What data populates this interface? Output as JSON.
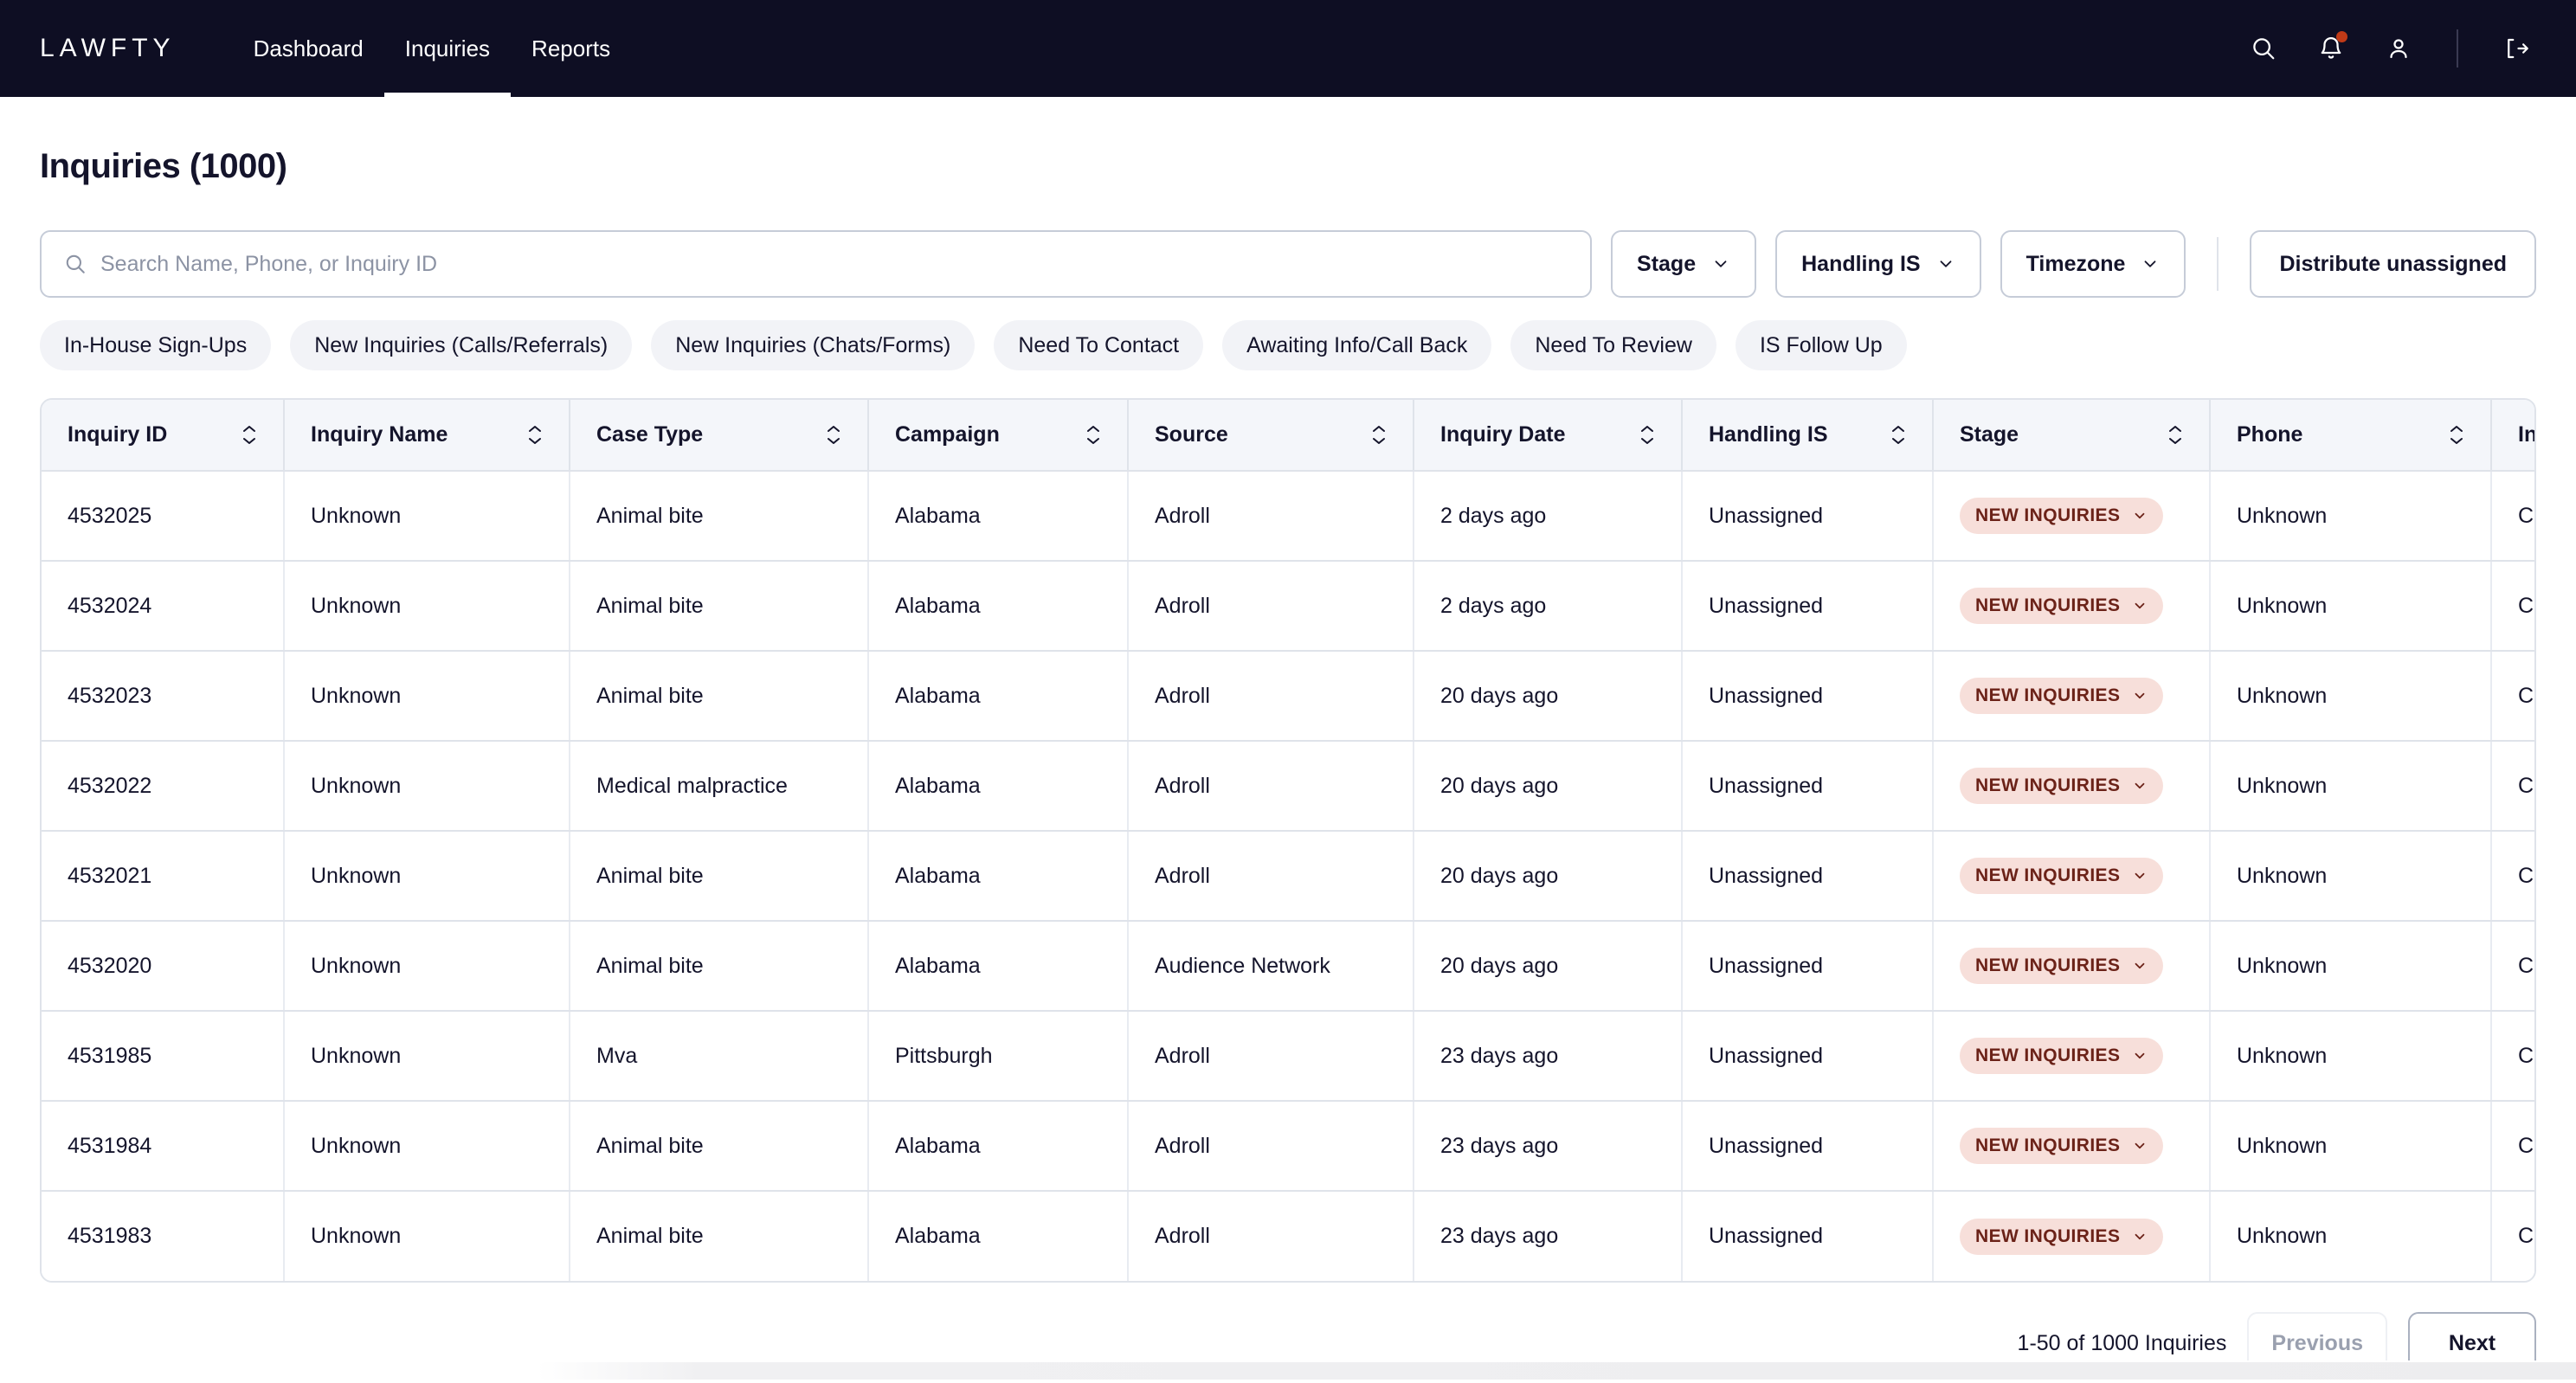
{
  "navbar": {
    "logo": "LAWFTY",
    "links": [
      {
        "label": "Dashboard",
        "active": false
      },
      {
        "label": "Inquiries",
        "active": true
      },
      {
        "label": "Reports",
        "active": false
      }
    ],
    "icons": [
      {
        "name": "search-icon"
      },
      {
        "name": "bell-icon",
        "badge": true
      },
      {
        "name": "user-icon"
      },
      {
        "name": "logout-icon"
      }
    ]
  },
  "page": {
    "title": "Inquiries (1000)"
  },
  "search": {
    "placeholder": "Search Name, Phone, or Inquiry ID",
    "value": ""
  },
  "filters": {
    "stage_label": "Stage",
    "handling_is_label": "Handling IS",
    "timezone_label": "Timezone",
    "distribute_label": "Distribute unassigned"
  },
  "chips": [
    "In-House Sign-Ups",
    "New Inquiries (Calls/Referrals)",
    "New Inquiries (Chats/Forms)",
    "Need To Contact",
    "Awaiting Info/Call Back",
    "Need To Review",
    "IS Follow Up"
  ],
  "table": {
    "columns": [
      "Inquiry ID",
      "Inquiry Name",
      "Case Type",
      "Campaign",
      "Source",
      "Inquiry Date",
      "Handling IS",
      "Stage",
      "Phone",
      "Inquiry Type"
    ],
    "rows": [
      {
        "inquiry_id": "4532025",
        "inquiry_name": "Unknown",
        "case_type": "Animal bite",
        "campaign": "Alabama",
        "source": "Adroll",
        "inquiry_date": "2 days ago",
        "handling_is": "Unassigned",
        "stage": "NEW INQUIRIES",
        "phone": "Unknown",
        "inquiry_type": "Call"
      },
      {
        "inquiry_id": "4532024",
        "inquiry_name": "Unknown",
        "case_type": "Animal bite",
        "campaign": "Alabama",
        "source": "Adroll",
        "inquiry_date": "2 days ago",
        "handling_is": "Unassigned",
        "stage": "NEW INQUIRIES",
        "phone": "Unknown",
        "inquiry_type": "Call"
      },
      {
        "inquiry_id": "4532023",
        "inquiry_name": "Unknown",
        "case_type": "Animal bite",
        "campaign": "Alabama",
        "source": "Adroll",
        "inquiry_date": "20 days ago",
        "handling_is": "Unassigned",
        "stage": "NEW INQUIRIES",
        "phone": "Unknown",
        "inquiry_type": "Call"
      },
      {
        "inquiry_id": "4532022",
        "inquiry_name": "Unknown",
        "case_type": "Medical malpractice",
        "campaign": "Alabama",
        "source": "Adroll",
        "inquiry_date": "20 days ago",
        "handling_is": "Unassigned",
        "stage": "NEW INQUIRIES",
        "phone": "Unknown",
        "inquiry_type": "Call"
      },
      {
        "inquiry_id": "4532021",
        "inquiry_name": "Unknown",
        "case_type": "Animal bite",
        "campaign": "Alabama",
        "source": "Adroll",
        "inquiry_date": "20 days ago",
        "handling_is": "Unassigned",
        "stage": "NEW INQUIRIES",
        "phone": "Unknown",
        "inquiry_type": "Call"
      },
      {
        "inquiry_id": "4532020",
        "inquiry_name": "Unknown",
        "case_type": "Animal bite",
        "campaign": "Alabama",
        "source": "Audience Network",
        "inquiry_date": "20 days ago",
        "handling_is": "Unassigned",
        "stage": "NEW INQUIRIES",
        "phone": "Unknown",
        "inquiry_type": "Call"
      },
      {
        "inquiry_id": "4531985",
        "inquiry_name": "Unknown",
        "case_type": "Mva",
        "campaign": "Pittsburgh",
        "source": "Adroll",
        "inquiry_date": "23 days ago",
        "handling_is": "Unassigned",
        "stage": "NEW INQUIRIES",
        "phone": "Unknown",
        "inquiry_type": "Call"
      },
      {
        "inquiry_id": "4531984",
        "inquiry_name": "Unknown",
        "case_type": "Animal bite",
        "campaign": "Alabama",
        "source": "Adroll",
        "inquiry_date": "23 days ago",
        "handling_is": "Unassigned",
        "stage": "NEW INQUIRIES",
        "phone": "Unknown",
        "inquiry_type": "Call"
      },
      {
        "inquiry_id": "4531983",
        "inquiry_name": "Unknown",
        "case_type": "Animal bite",
        "campaign": "Alabama",
        "source": "Adroll",
        "inquiry_date": "23 days ago",
        "handling_is": "Unassigned",
        "stage": "NEW INQUIRIES",
        "phone": "Unknown",
        "inquiry_type": "Call"
      }
    ]
  },
  "pagination": {
    "count_label": "1-50 of 1000 Inquiries",
    "previous_label": "Previous",
    "next_label": "Next"
  },
  "colors": {
    "navbar_bg": "#0e0e23",
    "text": "#14142b",
    "badge_bg": "#f7dfda",
    "badge_text": "#6b2218",
    "notification_dot": "#c03a17",
    "border": "#dfe3ea",
    "chip_bg": "#f2f3f7",
    "header_bg": "#f4f6fa"
  }
}
